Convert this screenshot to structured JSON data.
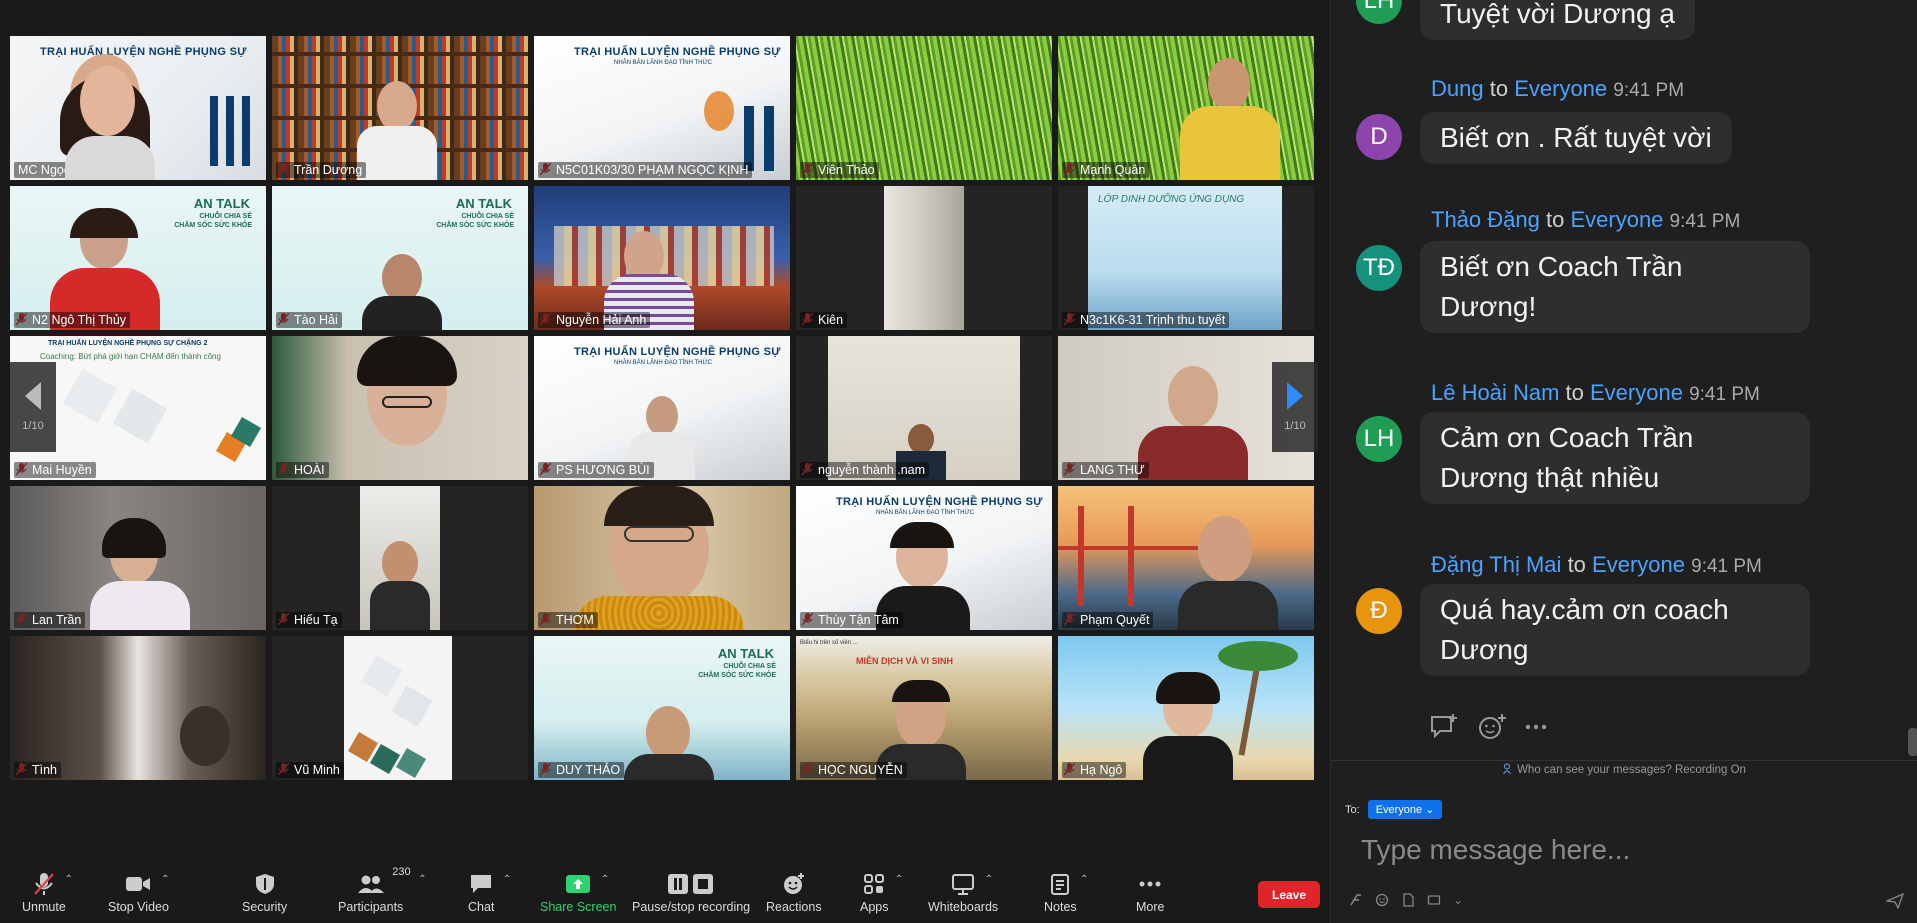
{
  "gallery": {
    "page_indicator_left": "1/10",
    "page_indicator_right": "1/10",
    "tiles": [
      {
        "name": "MC Ngọc Huyền",
        "muted": false
      },
      {
        "name": "Trần Dương",
        "muted": true
      },
      {
        "name": "N5C01K03/30 PHẠM NGỌC KỊNH",
        "muted": true
      },
      {
        "name": "Viên Thảo",
        "muted": true
      },
      {
        "name": "Mạnh Quân",
        "muted": true
      },
      {
        "name": "N2 Ngô Thị Thủy",
        "muted": true
      },
      {
        "name": "Tào Hải",
        "muted": true
      },
      {
        "name": "Nguyễn Hải Anh",
        "muted": true
      },
      {
        "name": "Kiên",
        "muted": true
      },
      {
        "name": "N3c1K6-31 Trịnh thu tuyết",
        "muted": true
      },
      {
        "name": "Mai Huyền",
        "muted": true
      },
      {
        "name": "HOÀI",
        "muted": true
      },
      {
        "name": "PS HƯƠNG BÙI",
        "muted": true
      },
      {
        "name": "nguyễn thành .nam",
        "muted": true
      },
      {
        "name": "LANG THƯ",
        "muted": true
      },
      {
        "name": "Lan Trần",
        "muted": true
      },
      {
        "name": "Hiếu Tạ",
        "muted": true
      },
      {
        "name": "THƠM",
        "muted": true
      },
      {
        "name": "Thùy Tận Tâm",
        "muted": true
      },
      {
        "name": "Phạm Quyết",
        "muted": true
      },
      {
        "name": "Tình",
        "muted": true
      },
      {
        "name": "Vũ Minh",
        "muted": true
      },
      {
        "name": "DUY THẢO",
        "muted": true
      },
      {
        "name": "HỌC NGUYỄN",
        "muted": true
      },
      {
        "name": "Hạ Ngô",
        "muted": true
      }
    ],
    "slides": {
      "trai_huan_luyen": "TRẠI HUẤN LUYỆN NGHỀ PHỤNG SỰ",
      "trai_sub": "NHÂN BẢN LÃNH ĐẠO TỈNH THỨC",
      "an_talk": "AN TALK",
      "an_talk_sub1": "CHUỖI CHIA SẺ",
      "an_talk_sub2": "CHĂM SÓC SỨC KHỎE",
      "lop_dinh_duong": "LỚP DINH DƯỠNG ỨNG DỤNG",
      "trai_chang": "TRẠI HUẤN LUYỆN NGHỀ PHỤNG SỰ CHẶNG 2",
      "coaching": "Coaching: Bứt phá giới hạn CHẠM đến thành công",
      "mien_dich": "MIỄN DỊCH VÀ VI SINH"
    }
  },
  "toolbar": {
    "unmute": "Unmute",
    "stop_video": "Stop Video",
    "security": "Security",
    "participants": "Participants",
    "participants_count": "230",
    "chat": "Chat",
    "share_screen": "Share Screen",
    "pause_recording": "Pause/stop recording",
    "reactions": "Reactions",
    "apps": "Apps",
    "whiteboards": "Whiteboards",
    "notes": "Notes",
    "more": "More",
    "leave": "Leave"
  },
  "chat": {
    "messages": [
      {
        "initials": "LH",
        "color": "#1f9d55",
        "sender": "",
        "to_text": "",
        "recipient": "",
        "time": "",
        "lines": [
          "Tuyệt vời Dương ạ"
        ]
      },
      {
        "initials": "D",
        "color": "#8e44ad",
        "sender": "Dung",
        "to_text": "to",
        "recipient": "Everyone",
        "time": "9:41 PM",
        "lines": [
          "Biết ơn . Rất tuyệt vời"
        ]
      },
      {
        "initials": "TĐ",
        "color": "#16917e",
        "sender": "Thảo Đặng",
        "to_text": "to",
        "recipient": "Everyone",
        "time": "9:41 PM",
        "lines": [
          "Biết ơn Coach Trần",
          "Dương!"
        ]
      },
      {
        "initials": "LH",
        "color": "#1f9d55",
        "sender": "Lê Hoài Nam",
        "to_text": "to",
        "recipient": "Everyone",
        "time": "9:41 PM",
        "lines": [
          "Cảm ơn Coach Trần",
          "Dương thật nhiều"
        ]
      },
      {
        "initials": "Đ",
        "color": "#e6950d",
        "sender": "Đặng Thị Mai",
        "to_text": "to",
        "recipient": "Everyone",
        "time": "9:41 PM",
        "lines": [
          "Quá hay.cảm ơn coach",
          "Dương"
        ]
      }
    ],
    "notice": "Who can see your messages? Recording On",
    "to_label": "To:",
    "recipient_select": "Everyone",
    "input_placeholder": "Type message here..."
  },
  "colors": {
    "accent_blue": "#2d8cff",
    "leave_red": "#e0242a",
    "share_green": "#2dd36f",
    "active_speaker": "#c7e34a"
  }
}
